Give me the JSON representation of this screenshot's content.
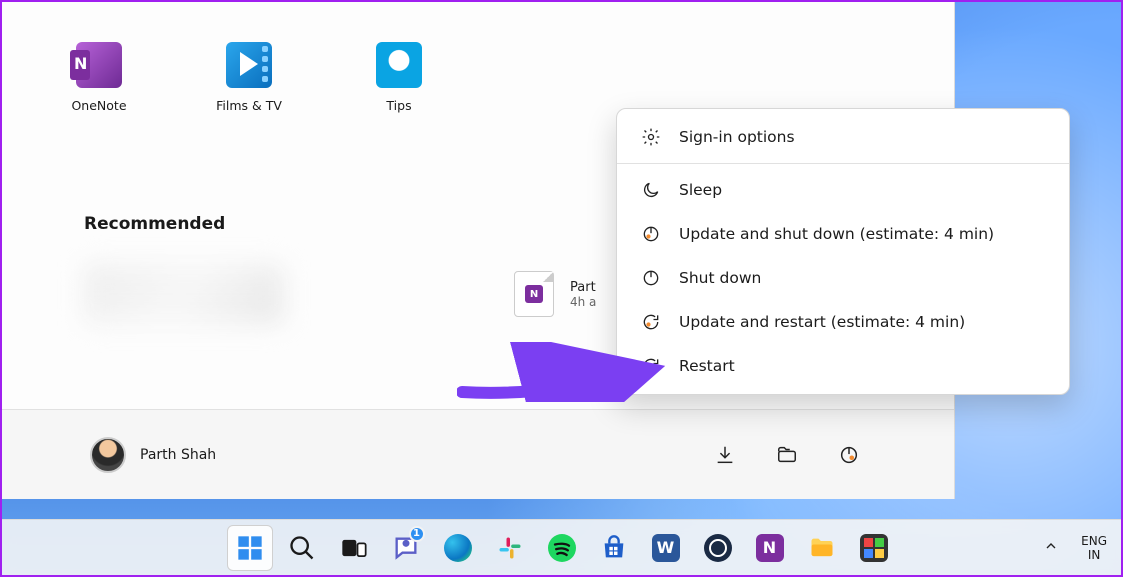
{
  "pinned_apps": [
    {
      "label": "OneNote"
    },
    {
      "label": "Films & TV"
    },
    {
      "label": "Tips"
    }
  ],
  "recommended_header": "Recommended",
  "recommended_item": {
    "title": "Part",
    "subtitle": "4h a"
  },
  "user": {
    "name": "Parth Shah"
  },
  "power_menu": {
    "sign_in_options": "Sign-in options",
    "sleep": "Sleep",
    "update_shutdown": "Update and shut down (estimate: 4 min)",
    "shutdown": "Shut down",
    "update_restart": "Update and restart (estimate: 4 min)",
    "restart": "Restart"
  },
  "taskbar": {
    "chat_badge": "1",
    "language_line1": "ENG",
    "language_line2": "IN"
  }
}
